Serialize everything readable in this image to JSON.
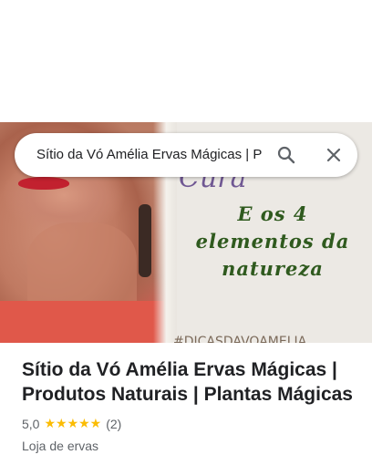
{
  "search": {
    "query": "Sítio da Vó Amélia Ervas Mágicas | P"
  },
  "hero": {
    "script_text": "Cura",
    "heading_lines": [
      "E os 4",
      "elementos da",
      "natureza"
    ],
    "hashtag": "#DICASDAVÓAMELIA"
  },
  "place": {
    "title": "Sítio da Vó Amélia Ervas Mágicas | Produtos Naturais | Plantas Mágicas",
    "rating": "5,0",
    "stars": "★★★★★",
    "review_count": "(2)",
    "category": "Loja de ervas"
  },
  "colors": {
    "accent": "#fbbc04",
    "hero_text": "#2f5a1e",
    "text_primary": "#202124",
    "text_secondary": "#5f6368"
  },
  "icons": {
    "search": "search-icon",
    "close": "close-icon"
  }
}
